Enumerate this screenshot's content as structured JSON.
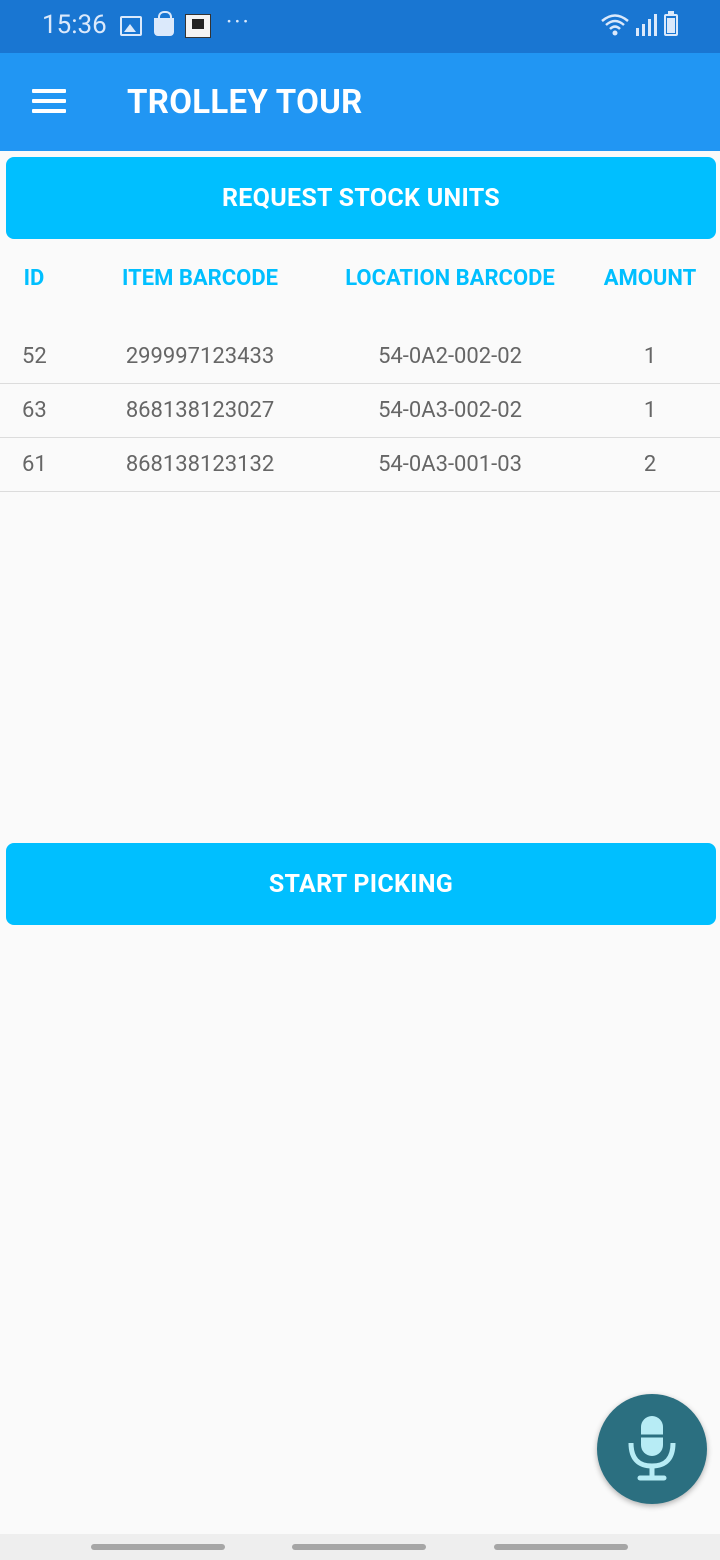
{
  "status_bar": {
    "time": "15:36",
    "dots": "···",
    "icons": [
      "image-icon",
      "bag-icon",
      "app-notification-icon",
      "wifi-icon",
      "signal-icon",
      "battery-icon"
    ]
  },
  "app_bar": {
    "title": "TROLLEY TOUR",
    "menu_icon": "menu-icon",
    "background": "#2196f3"
  },
  "buttons": {
    "request_label": "REQUEST STOCK UNITS",
    "start_label": "START PICKING",
    "color": "#00bfff"
  },
  "table": {
    "headers": {
      "id": "ID",
      "item_barcode": "ITEM BARCODE",
      "location_barcode": "LOCATION BARCODE",
      "amount": "AMOUNT"
    },
    "rows": [
      {
        "id": "52",
        "item_barcode": "299997123433",
        "location_barcode": "54-0A2-002-02",
        "amount": "1"
      },
      {
        "id": "63",
        "item_barcode": "868138123027",
        "location_barcode": "54-0A3-002-02",
        "amount": "1"
      },
      {
        "id": "61",
        "item_barcode": "868138123132",
        "location_barcode": "54-0A3-001-03",
        "amount": "2"
      }
    ]
  },
  "fab": {
    "icon": "microphone-icon",
    "color": "#2b6f80"
  }
}
